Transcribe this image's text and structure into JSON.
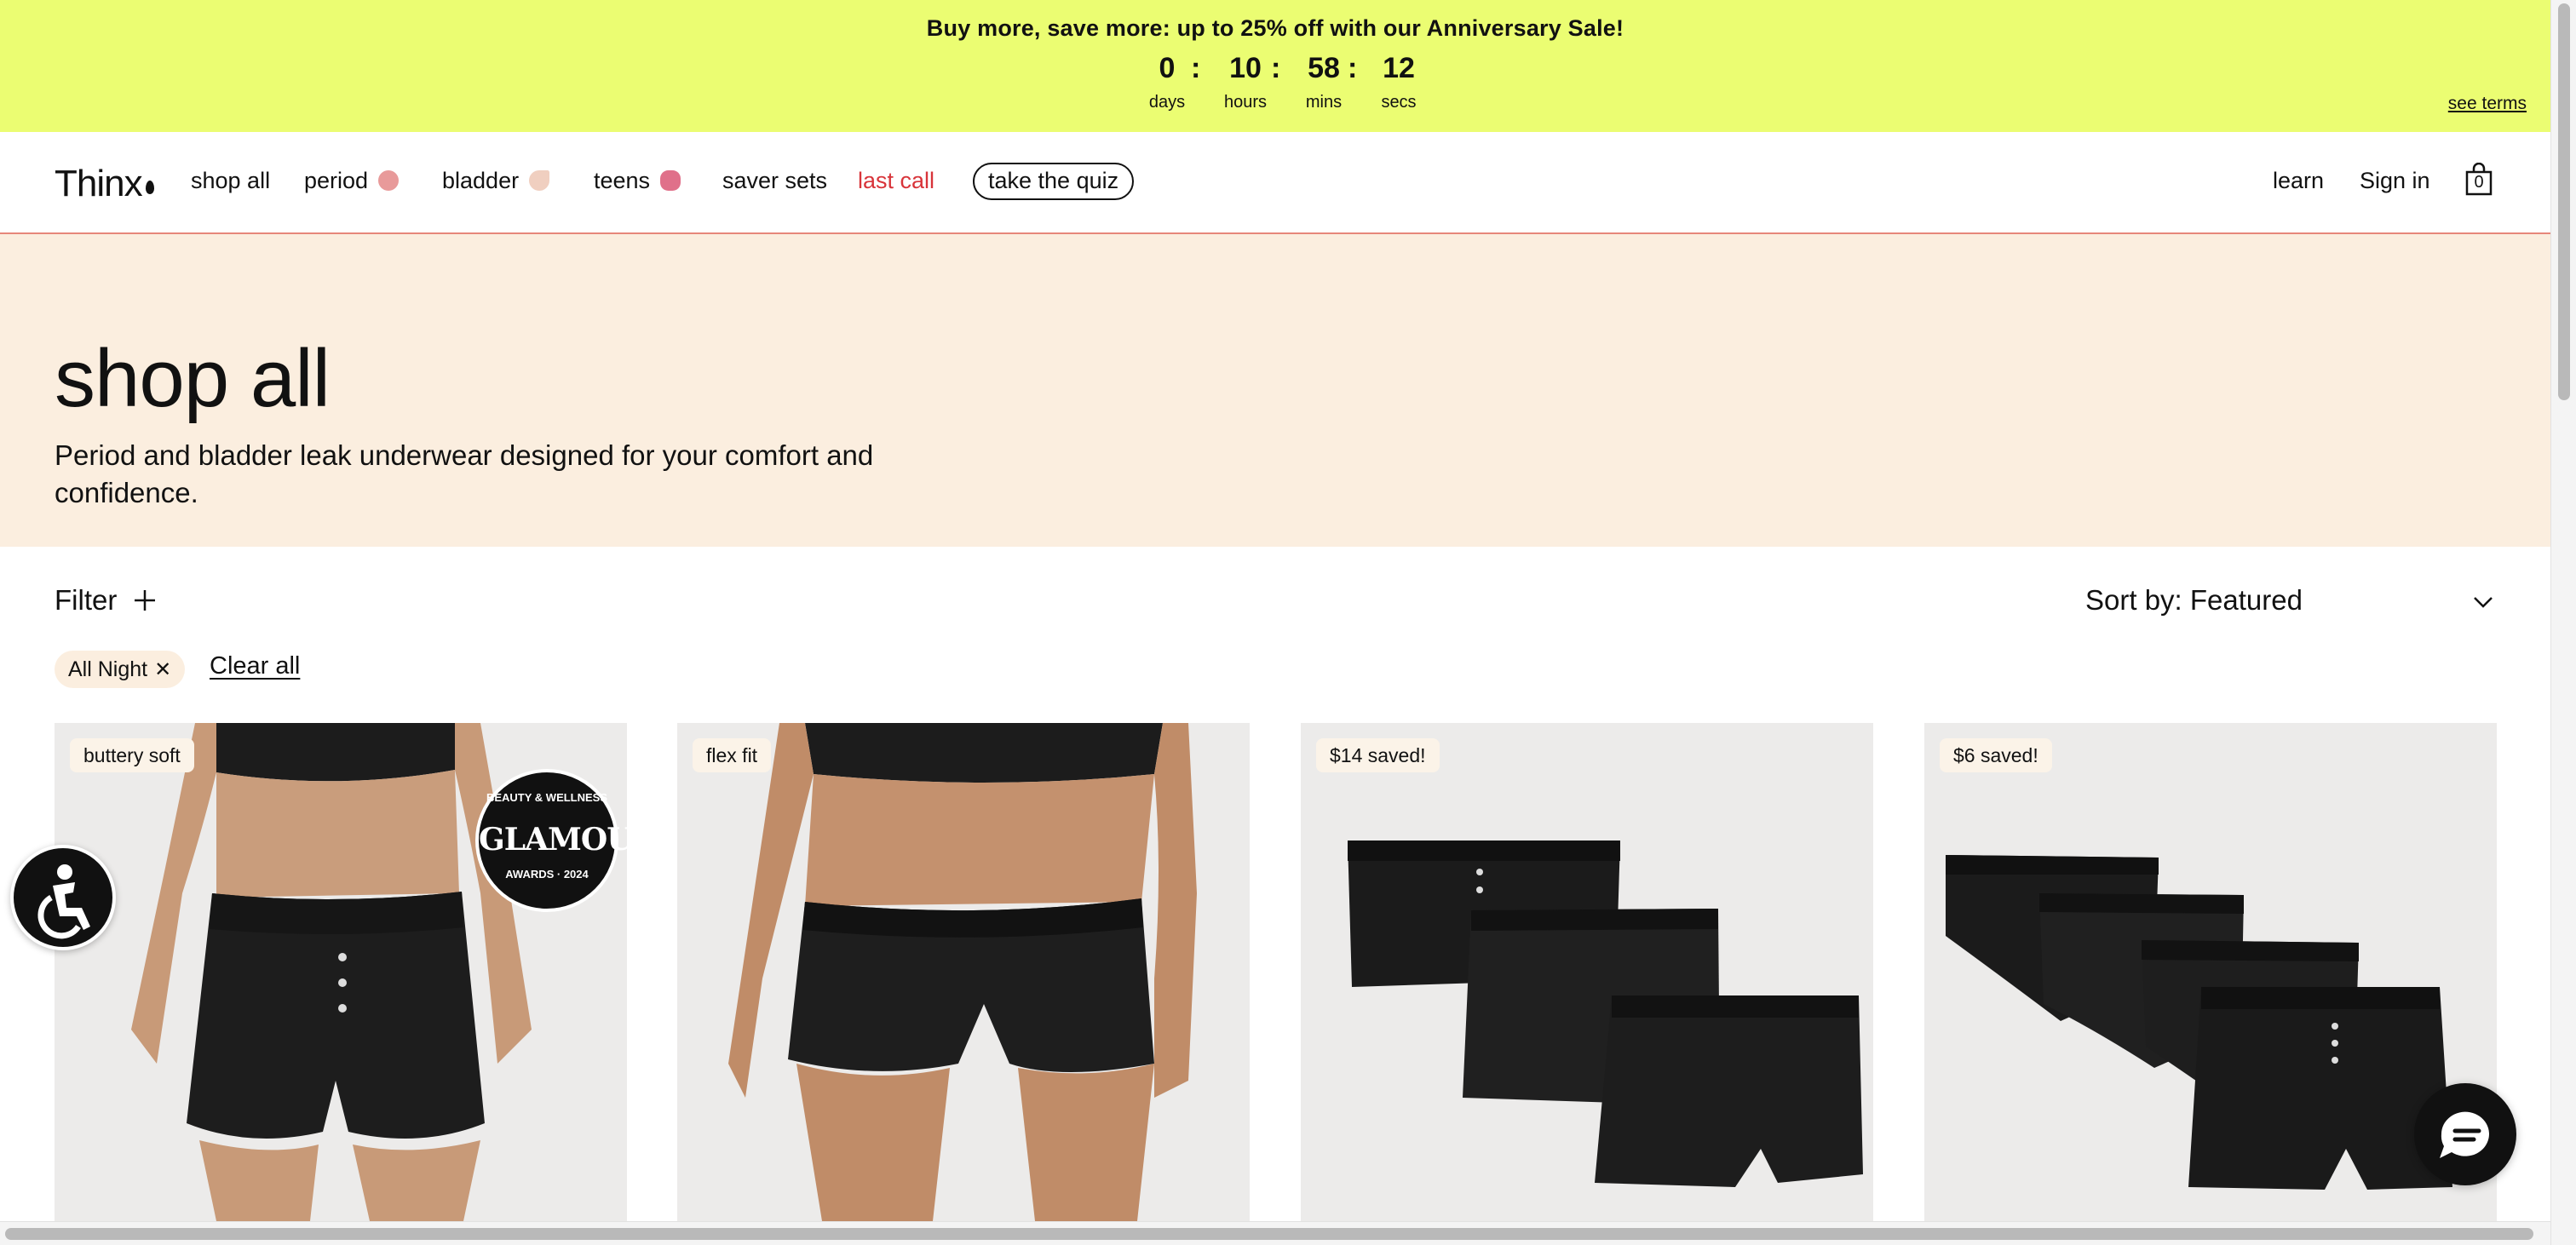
{
  "promo": {
    "text": "Buy more, save more: up to 25% off with our  Anniversary Sale!",
    "countdown": [
      {
        "value": "0",
        "label": "days"
      },
      {
        "value": "10",
        "label": "hours"
      },
      {
        "value": "58",
        "label": "mins"
      },
      {
        "value": "12",
        "label": "secs"
      }
    ],
    "separator": ":",
    "see_terms": "see terms",
    "background": "#ebfd72"
  },
  "nav": {
    "logo": "Thinx",
    "items": [
      {
        "label": "shop all"
      },
      {
        "label": "period",
        "dot_color": "#e89a9a"
      },
      {
        "label": "bladder",
        "dot_color": "#f0cfc0"
      },
      {
        "label": "teens",
        "dot_color": "#e0708a"
      },
      {
        "label": "saver sets"
      },
      {
        "label": "last call",
        "color": "#d8343a"
      }
    ],
    "quiz": "take the quiz",
    "learn": "learn",
    "sign_in": "Sign in",
    "cart_count": "0"
  },
  "hero": {
    "title": "shop all",
    "subtitle": "Period and bladder leak underwear designed for your comfort and confidence.",
    "background": "#fbeedf"
  },
  "filters": {
    "filter_label": "Filter",
    "sort_label": "Sort by: Featured",
    "active_chip": "All Night",
    "clear_all": "Clear all"
  },
  "products": [
    {
      "tag": "buttery soft",
      "badge": {
        "top": "BEAUTY & WELLNESS",
        "main": "GLAMOUR",
        "bottom": "AWARDS · 2024"
      }
    },
    {
      "tag": "flex fit"
    },
    {
      "tag": "$14 saved!"
    },
    {
      "tag": "$6 saved!"
    }
  ],
  "icons": {
    "accessibility": "accessibility-icon",
    "chat": "chat-icon",
    "cart": "shopping-bag-icon",
    "filter": "plus-icon",
    "sort": "chevron-down-icon"
  }
}
